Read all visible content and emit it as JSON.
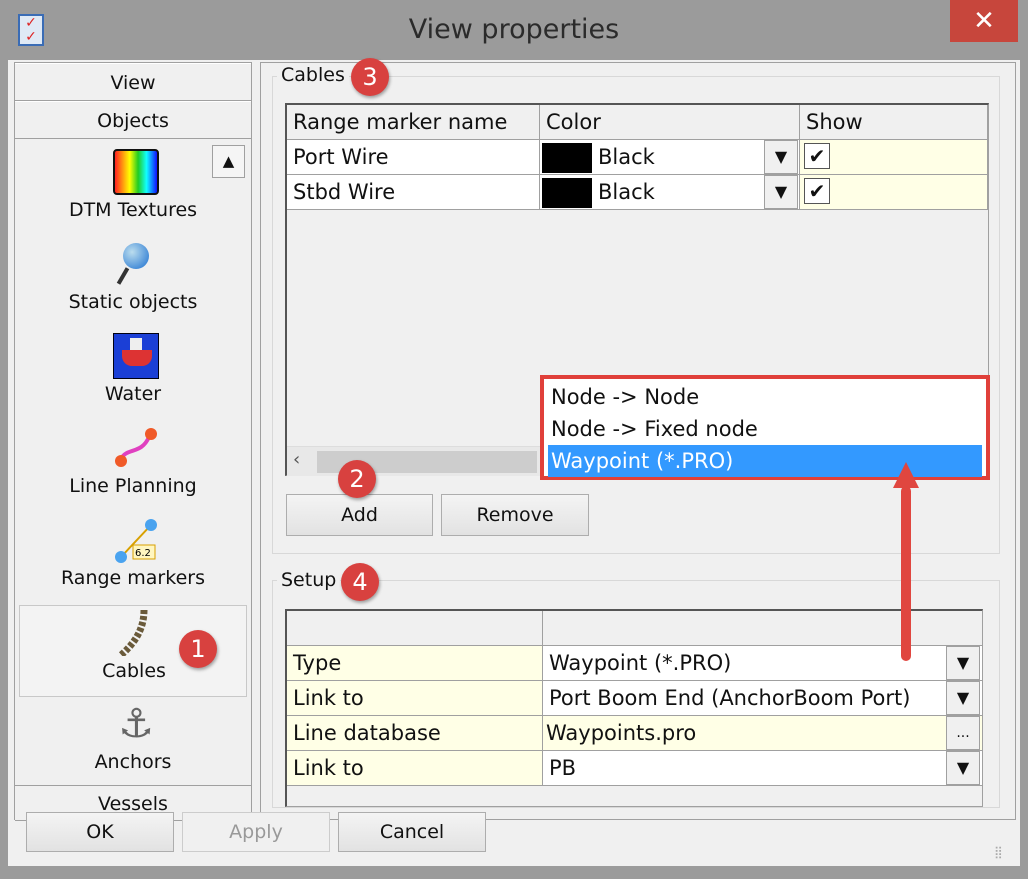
{
  "window": {
    "title": "View properties",
    "close_icon": "close-icon"
  },
  "sidebar": {
    "categories": [
      "View",
      "Objects",
      "Vessels"
    ],
    "items": [
      {
        "label": "DTM Textures",
        "icon": "dtm-textures-icon"
      },
      {
        "label": "Static objects",
        "icon": "static-objects-icon"
      },
      {
        "label": "Water",
        "icon": "water-icon"
      },
      {
        "label": "Line Planning",
        "icon": "line-planning-icon"
      },
      {
        "label": "Range markers",
        "icon": "range-markers-icon"
      },
      {
        "label": "Cables",
        "icon": "cables-icon",
        "selected": true
      },
      {
        "label": "Anchors",
        "icon": "anchors-icon"
      }
    ],
    "range_marker_icon_text": "6.2"
  },
  "cables": {
    "group_label": "Cables",
    "columns": [
      "Range marker name",
      "Color",
      "Show"
    ],
    "rows": [
      {
        "name": "Port Wire",
        "color": "Black",
        "color_hex": "#000000",
        "show": true
      },
      {
        "name": "Stbd Wire",
        "color": "Black",
        "color_hex": "#000000",
        "show": true
      }
    ],
    "add_label": "Add",
    "remove_label": "Remove"
  },
  "dropdown_popup": {
    "options": [
      "Node -> Node",
      "Node -> Fixed node",
      "Waypoint (*.PRO)"
    ],
    "selected_index": 2
  },
  "setup": {
    "group_label": "Setup",
    "rows": [
      {
        "label": "Type",
        "value": "Waypoint (*.PRO)",
        "control": "dropdown"
      },
      {
        "label": "Link to",
        "value": "Port Boom End (AnchorBoom Port)",
        "control": "dropdown"
      },
      {
        "label": "Line database",
        "value": "Waypoints.pro",
        "control": "browse",
        "button": "..."
      },
      {
        "label": "Link to",
        "value": "PB",
        "control": "dropdown"
      }
    ]
  },
  "footer": {
    "ok": "OK",
    "apply": "Apply",
    "cancel": "Cancel"
  },
  "annotations": [
    "1",
    "2",
    "3",
    "4"
  ],
  "colors": {
    "annotation": "#d8413f",
    "selection": "#3399ff",
    "highlight_border": "#e0403a"
  }
}
